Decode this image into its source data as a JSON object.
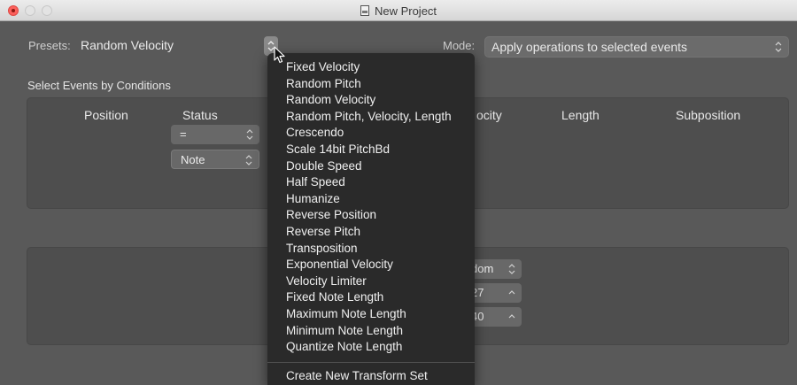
{
  "window": {
    "title": "New Project"
  },
  "presets": {
    "label": "Presets:",
    "value": "Random Velocity"
  },
  "mode": {
    "label": "Mode:",
    "value": "Apply operations to selected events"
  },
  "conditions": {
    "title": "Select Events by Conditions",
    "columns": [
      "Position",
      "Status",
      "",
      "ocity",
      "Length",
      "Subposition"
    ],
    "status_operator": "=",
    "status_value": "Note"
  },
  "operations": {
    "row1": "dom",
    "row2": "27",
    "row3": "40"
  },
  "menu": {
    "items": [
      "Fixed Velocity",
      "Random Pitch",
      "Random Velocity",
      "Random Pitch, Velocity, Length",
      "Crescendo",
      "Scale 14bit PitchBd",
      "Double Speed",
      "Half Speed",
      "Humanize",
      "Reverse Position",
      "Reverse Pitch",
      "Transposition",
      "Exponential Velocity",
      "Velocity Limiter",
      "Fixed Note Length",
      "Maximum Note Length",
      "Minimum Note Length",
      "Quantize Note Length"
    ],
    "create_label": "Create New Transform Set"
  },
  "icons": {
    "updown": "⌃⌄",
    "up": "^"
  }
}
